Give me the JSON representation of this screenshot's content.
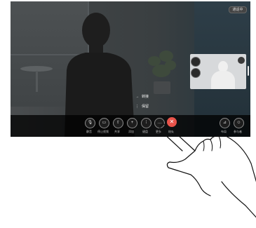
{
  "status_pill": "通话中",
  "menu": [
    {
      "icon": "→",
      "label": "转接"
    },
    {
      "icon": "⋮",
      "label": "保留"
    }
  ],
  "controls": [
    {
      "icon": "mic-icon",
      "glyph": "🎙",
      "label": "静音"
    },
    {
      "icon": "camera-icon",
      "glyph": "▭",
      "label": "停止视频"
    },
    {
      "icon": "share-icon",
      "glyph": "⇧",
      "label": "共享"
    },
    {
      "icon": "add-icon",
      "glyph": "+",
      "label": "添加"
    },
    {
      "icon": "keypad-icon",
      "glyph": "⁞",
      "label": "键盘"
    },
    {
      "icon": "more-icon",
      "glyph": "…",
      "label": "更多"
    },
    {
      "icon": "end-call-icon",
      "glyph": "✕",
      "label": "结束"
    },
    {
      "icon": "layout-icon",
      "glyph": "⊿",
      "label": "布局"
    },
    {
      "icon": "participants-icon",
      "glyph": "☺",
      "label": "参与者"
    }
  ],
  "colors": {
    "end_call": "#e8534a",
    "bar": "#000000"
  }
}
